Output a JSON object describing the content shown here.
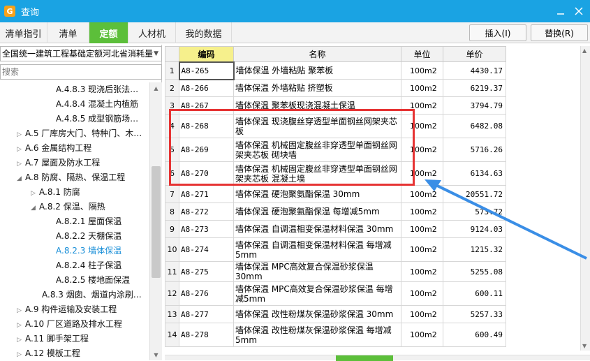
{
  "window": {
    "title": "查询",
    "app_icon": "app-logo-icon",
    "controls": [
      "minimize-icon",
      "close-icon"
    ]
  },
  "tabs": [
    {
      "label": "清单指引",
      "active": false
    },
    {
      "label": "清单",
      "active": false
    },
    {
      "label": "定额",
      "active": true
    },
    {
      "label": "人材机",
      "active": false
    },
    {
      "label": "我的数据",
      "active": false
    }
  ],
  "actions": {
    "insert": "插入(I)",
    "replace": "替换(R)"
  },
  "library_select": {
    "value": "全国统一建筑工程基础定额河北省消耗量"
  },
  "search": {
    "placeholder": "搜索"
  },
  "tree": [
    {
      "label": "A.4.8.3 现浇后张法…",
      "expander": "",
      "indent": 80
    },
    {
      "label": "A.4.8.4 混凝土内植筋",
      "expander": "",
      "indent": 80
    },
    {
      "label": "A.4.8.5 成型钢筋场…",
      "expander": "",
      "indent": 80
    },
    {
      "label": "A.5 厂库房大门、特种门、木…",
      "expander": "▷",
      "indent": 24
    },
    {
      "label": "A.6 金属结构工程",
      "expander": "▷",
      "indent": 24
    },
    {
      "label": "A.7 屋面及防水工程",
      "expander": "▷",
      "indent": 24
    },
    {
      "label": "A.8 防腐、隔热、保温工程",
      "expander": "◢",
      "indent": 24
    },
    {
      "label": "A.8.1 防腐",
      "expander": "▷",
      "indent": 44
    },
    {
      "label": "A.8.2 保温、隔热",
      "expander": "◢",
      "indent": 44
    },
    {
      "label": "A.8.2.1 屋面保温",
      "expander": "",
      "indent": 80
    },
    {
      "label": "A.8.2.2 天棚保温",
      "expander": "",
      "indent": 80
    },
    {
      "label": "A.8.2.3 墙体保温",
      "expander": "",
      "indent": 80,
      "selected": true
    },
    {
      "label": "A.8.2.4 柱子保温",
      "expander": "",
      "indent": 80
    },
    {
      "label": "A.8.2.5 楼地面保温",
      "expander": "",
      "indent": 80
    },
    {
      "label": "A.8.3 烟囱、烟道内涂刷…",
      "expander": "",
      "indent": 60
    },
    {
      "label": "A.9 构件运输及安装工程",
      "expander": "▷",
      "indent": 24
    },
    {
      "label": "A.10 厂区道路及排水工程",
      "expander": "▷",
      "indent": 24
    },
    {
      "label": "A.11 脚手架工程",
      "expander": "▷",
      "indent": 24
    },
    {
      "label": "A.12 模板工程",
      "expander": "▷",
      "indent": 24
    }
  ],
  "grid": {
    "columns": [
      "",
      "编码",
      "名称",
      "单位",
      "单价"
    ],
    "rows": [
      {
        "idx": "1",
        "code": "A8-265",
        "name": "墙体保温 外墙粘贴 聚苯板",
        "unit": "100m2",
        "price": "4430.17"
      },
      {
        "idx": "2",
        "code": "A8-266",
        "name": "墙体保温 外墙粘贴 挤塑板",
        "unit": "100m2",
        "price": "6219.37"
      },
      {
        "idx": "3",
        "code": "A8-267",
        "name": "墙体保温 聚苯板现浇混凝土保温",
        "unit": "100m2",
        "price": "3794.79"
      },
      {
        "idx": "4",
        "code": "A8-268",
        "name": "墙体保温 现浇腹丝穿透型单面钢丝网架夹芯板",
        "unit": "100m2",
        "price": "6482.08"
      },
      {
        "idx": "5",
        "code": "A8-269",
        "name": "墙体保温 机械固定腹丝非穿透型单面钢丝网架夹芯板 砌块墙",
        "unit": "100m2",
        "price": "5716.26"
      },
      {
        "idx": "6",
        "code": "A8-270",
        "name": "墙体保温 机械固定腹丝非穿透型单面钢丝网架夹芯板 混凝土墙",
        "unit": "100m2",
        "price": "6134.63"
      },
      {
        "idx": "7",
        "code": "A8-271",
        "name": "墙体保温 硬泡聚氨酯保温 30mm",
        "unit": "100m2",
        "price": "20551.72"
      },
      {
        "idx": "8",
        "code": "A8-272",
        "name": "墙体保温 硬泡聚氨酯保温 每增减5mm",
        "unit": "100m2",
        "price": "573.72"
      },
      {
        "idx": "9",
        "code": "A8-273",
        "name": "墙体保温 自调温相变保温材料保温 30mm",
        "unit": "100m2",
        "price": "9124.03"
      },
      {
        "idx": "10",
        "code": "A8-274",
        "name": "墙体保温 自调温相变保温材料保温 每增减5mm",
        "unit": "100m2",
        "price": "1215.32"
      },
      {
        "idx": "11",
        "code": "A8-275",
        "name": "墙体保温 MPC高效复合保温砂浆保温 30mm",
        "unit": "100m2",
        "price": "5255.08"
      },
      {
        "idx": "12",
        "code": "A8-276",
        "name": "墙体保温 MPC高效复合保温砂浆保温 每增减5mm",
        "unit": "100m2",
        "price": "600.11"
      },
      {
        "idx": "13",
        "code": "A8-277",
        "name": "墙体保温 改性粉煤灰保温砂浆保温 30mm",
        "unit": "100m2",
        "price": "5257.33"
      },
      {
        "idx": "14",
        "code": "A8-278",
        "name": "墙体保温 改性粉煤灰保温砂浆保温 每增减5mm",
        "unit": "100m2",
        "price": "600.49"
      }
    ]
  },
  "annotation": {
    "box_color": "#e63333",
    "arrow_color": "#3a8ee6"
  }
}
